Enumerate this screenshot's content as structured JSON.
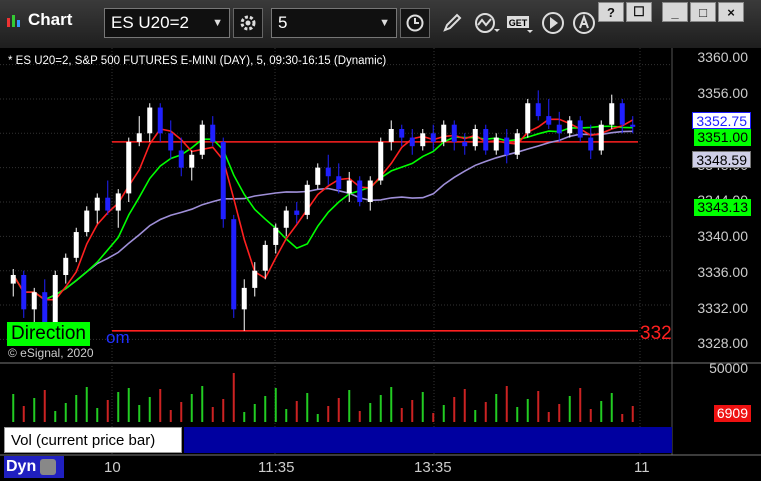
{
  "app": {
    "title": "Chart"
  },
  "toolbar": {
    "symbol": "ES U20=2",
    "interval": "5",
    "buttons": [
      "settings-icon",
      "time-icon",
      "pencil-icon",
      "study-icon",
      "get-icon",
      "play-icon",
      "cursor-icon"
    ],
    "get_label": "GET"
  },
  "window_buttons": [
    "?",
    "☐",
    "_",
    "□",
    "×"
  ],
  "chart": {
    "header": "* ES U20=2, S&P 500 FUTURES E-MINI (DAY), 5, 09:30-16:15 (Dynamic)",
    "copyright": "© eSignal, 2020",
    "direction_label": "Direction",
    "direction_tail": "om",
    "overlay_value": "332"
  },
  "price_labels": {
    "last": "3352.75",
    "green_line": "3351.00",
    "purple_line": "3348.59",
    "lower_green": "3343.13",
    "volume": "6909"
  },
  "price_axis": [
    "3360.00",
    "3356.00",
    "3348.00",
    "3344.00",
    "3340.00",
    "3336.00",
    "3332.00",
    "3328.00"
  ],
  "volume_axis": [
    "50000"
  ],
  "volume_panel": {
    "label": "Vol (current price bar)",
    "close": "×"
  },
  "bottom": {
    "dyn": "Dyn",
    "times": [
      "10",
      "11:35",
      "13:35",
      "11"
    ]
  },
  "colors": {
    "bull": "#ffffff",
    "bear": "#2020ff",
    "red_line": "#ff2020",
    "green_line": "#00ff00",
    "purple_line": "#9f8fd8",
    "grid": "#333333"
  },
  "chart_data": {
    "type": "candlestick",
    "candles": [
      [
        3334.5,
        3336.2,
        3333.0,
        3335.5
      ],
      [
        3335.5,
        3336.0,
        3330.5,
        3331.5
      ],
      [
        3331.5,
        3334.0,
        3330.0,
        3333.5
      ],
      [
        3333.5,
        3335.0,
        3329.0,
        3330.0
      ],
      [
        3330.0,
        3336.0,
        3329.5,
        3335.5
      ],
      [
        3335.5,
        3338.0,
        3334.5,
        3337.5
      ],
      [
        3337.5,
        3341.0,
        3337.0,
        3340.5
      ],
      [
        3340.5,
        3343.5,
        3340.0,
        3343.0
      ],
      [
        3343.0,
        3345.0,
        3341.5,
        3344.5
      ],
      [
        3344.5,
        3346.5,
        3342.5,
        3343.0
      ],
      [
        3343.0,
        3345.5,
        3341.0,
        3345.0
      ],
      [
        3345.0,
        3351.5,
        3344.0,
        3351.0
      ],
      [
        3351.0,
        3354.0,
        3350.5,
        3352.0
      ],
      [
        3352.0,
        3355.5,
        3351.0,
        3355.0
      ],
      [
        3355.0,
        3355.5,
        3351.0,
        3352.0
      ],
      [
        3352.0,
        3353.5,
        3349.0,
        3350.0
      ],
      [
        3350.0,
        3351.5,
        3347.0,
        3348.0
      ],
      [
        3348.0,
        3350.0,
        3346.5,
        3349.5
      ],
      [
        3349.5,
        3353.5,
        3349.0,
        3353.0
      ],
      [
        3353.0,
        3354.0,
        3350.5,
        3351.0
      ],
      [
        3351.0,
        3351.5,
        3341.0,
        3342.0
      ],
      [
        3342.0,
        3342.5,
        3330.5,
        3331.5
      ],
      [
        3331.5,
        3335.0,
        3329.0,
        3334.0
      ],
      [
        3334.0,
        3337.0,
        3333.0,
        3336.0
      ],
      [
        3336.0,
        3339.5,
        3335.0,
        3339.0
      ],
      [
        3339.0,
        3341.5,
        3338.0,
        3341.0
      ],
      [
        3341.0,
        3343.5,
        3340.0,
        3343.0
      ],
      [
        3343.0,
        3344.0,
        3341.5,
        3342.5
      ],
      [
        3342.5,
        3346.5,
        3342.0,
        3346.0
      ],
      [
        3346.0,
        3348.5,
        3345.5,
        3348.0
      ],
      [
        3348.0,
        3349.5,
        3346.0,
        3347.0
      ],
      [
        3347.0,
        3348.5,
        3345.0,
        3345.5
      ],
      [
        3345.0,
        3347.5,
        3344.0,
        3346.5
      ],
      [
        3346.5,
        3347.0,
        3343.5,
        3344.0
      ],
      [
        3344.0,
        3347.0,
        3343.0,
        3346.5
      ],
      [
        3346.5,
        3351.5,
        3346.0,
        3351.0
      ],
      [
        3351.0,
        3353.5,
        3350.0,
        3352.5
      ],
      [
        3352.5,
        3353.0,
        3350.5,
        3351.5
      ],
      [
        3351.5,
        3352.5,
        3349.5,
        3350.5
      ],
      [
        3350.5,
        3352.5,
        3350.0,
        3352.0
      ],
      [
        3352.0,
        3353.0,
        3350.0,
        3351.0
      ],
      [
        3351.0,
        3353.5,
        3350.5,
        3353.0
      ],
      [
        3353.0,
        3353.5,
        3350.0,
        3351.0
      ],
      [
        3351.0,
        3352.0,
        3349.5,
        3350.5
      ],
      [
        3350.5,
        3353.0,
        3350.0,
        3352.5
      ],
      [
        3352.5,
        3353.0,
        3349.5,
        3350.0
      ],
      [
        3350.0,
        3352.0,
        3349.5,
        3351.5
      ],
      [
        3351.5,
        3352.5,
        3348.5,
        3349.5
      ],
      [
        3349.5,
        3352.5,
        3349.0,
        3352.0
      ],
      [
        3352.0,
        3356.0,
        3351.5,
        3355.5
      ],
      [
        3355.5,
        3357.0,
        3353.5,
        3354.0
      ],
      [
        3354.0,
        3356.0,
        3352.5,
        3353.0
      ],
      [
        3353.0,
        3354.5,
        3351.0,
        3352.0
      ],
      [
        3352.0,
        3354.0,
        3351.5,
        3353.5
      ],
      [
        3353.5,
        3354.0,
        3351.0,
        3351.5
      ],
      [
        3351.5,
        3353.0,
        3349.0,
        3350.0
      ],
      [
        3350.0,
        3353.5,
        3349.5,
        3353.0
      ],
      [
        3353.0,
        3356.5,
        3352.5,
        3355.5
      ],
      [
        3355.5,
        3356.0,
        3352.0,
        3353.0
      ],
      [
        3353.0,
        3354.0,
        3352.0,
        3352.75
      ]
    ],
    "red_level": 3351.0,
    "bottom_red_level": 3329.0,
    "ylim": [
      3327,
      3361
    ]
  }
}
